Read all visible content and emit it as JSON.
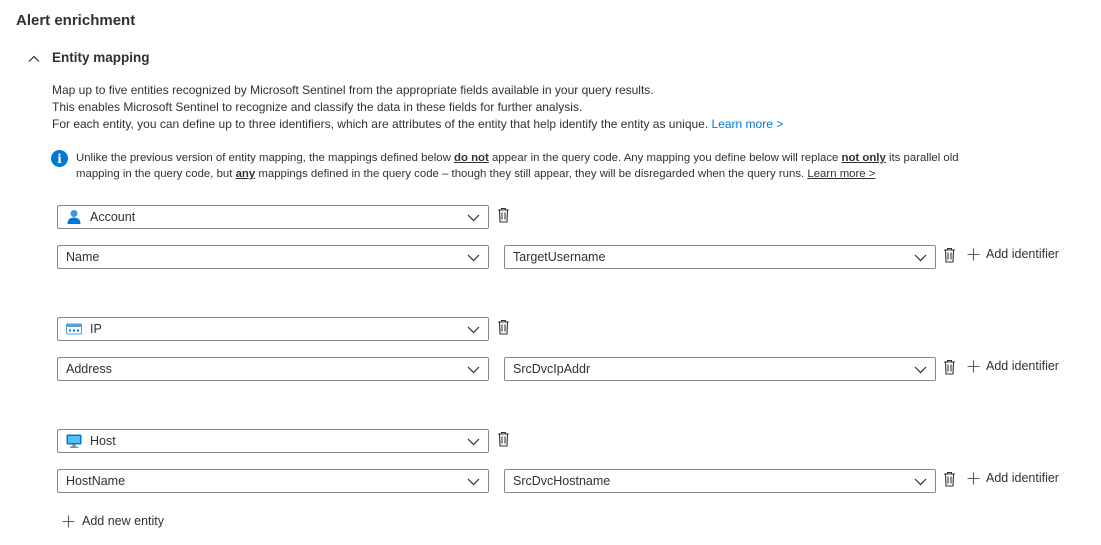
{
  "header": {
    "title": "Alert enrichment",
    "subtitle": "Entity mapping"
  },
  "description": {
    "line1": "Map up to five entities recognized by Microsoft Sentinel from the appropriate fields available in your query results.",
    "line2": "This enables Microsoft Sentinel to recognize and classify the data in these fields for further analysis.",
    "line3": "For each entity, you can define up to three identifiers, which are attributes of the entity that help identify the entity as unique.",
    "learn_more": "Learn more >"
  },
  "info": {
    "icon": "info-icon",
    "p1": "Unlike the previous version of entity mapping, the mappings defined below ",
    "b1": "do not",
    "p2": " appear in the query code. Any mapping you define below will replace ",
    "b2": "not only",
    "p3": " its parallel old",
    "p4": "mapping in the query code, but ",
    "b3": "any",
    "p5": " mappings defined in the query code – though they still appear, they will be disregarded when the query runs. ",
    "learn_more": "Learn more >"
  },
  "entities": [
    {
      "type": "Account",
      "icon": "account-icon",
      "identifier": "Name",
      "column": "TargetUsername",
      "add_label": "Add identifier"
    },
    {
      "type": "IP",
      "icon": "ip-icon",
      "identifier": "Address",
      "column": "SrcDvcIpAddr",
      "add_label": "Add identifier"
    },
    {
      "type": "Host",
      "icon": "host-icon",
      "identifier": "HostName",
      "column": "SrcDvcHostname",
      "add_label": "Add identifier"
    }
  ],
  "add_entity_label": "Add new entity",
  "colors": {
    "accent": "#0078d4",
    "border": "#8a8886",
    "text": "#323130"
  }
}
